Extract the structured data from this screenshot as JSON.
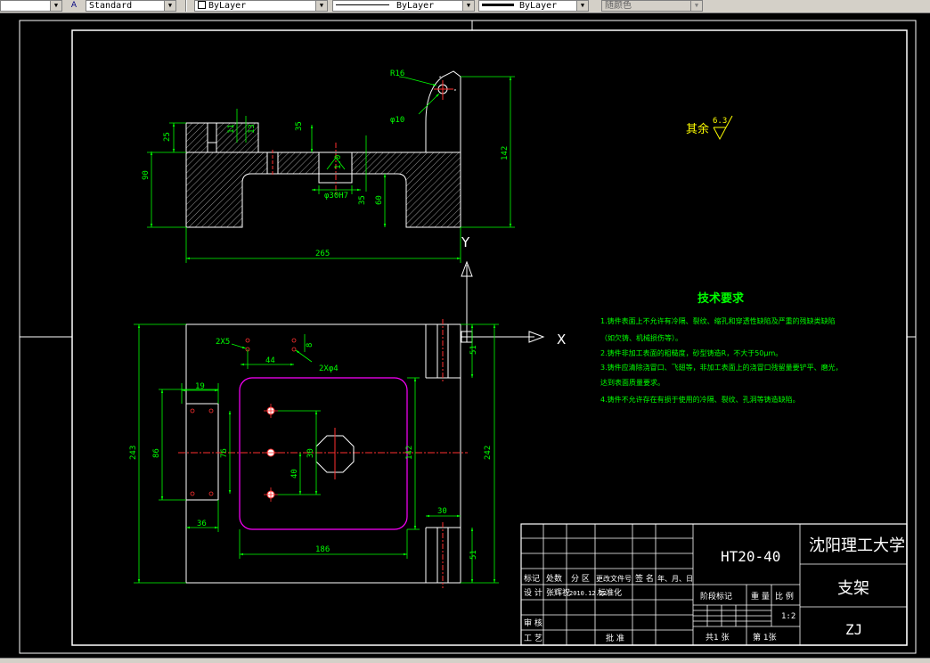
{
  "toolbar": {
    "text_style": "Standard",
    "layer": "ByLayer",
    "linetype": "ByLayer",
    "lineweight": "ByLayer",
    "plot_style": "随颜色"
  },
  "top_view": {
    "r16": "R16",
    "phi10": "φ10",
    "dim_11": "11",
    "dim_13": "13",
    "dim_35": "35",
    "dim_25": "25",
    "dim_90": "90",
    "dim_10": "1.0",
    "dim_phi30": "φ30H7",
    "dim_5": "35",
    "dim_60": "60",
    "dim_142": "142",
    "dim_265": "265"
  },
  "surface_note": {
    "label": "其余",
    "value": "6.3"
  },
  "tech_requirements": {
    "title": "技术要求",
    "lines": [
      "1.铸件表面上不允许有冷隔、裂纹、缩孔和穿透性缺陷及严重的残缺类缺陷",
      "（如欠铸、机械损伤等）。",
      "2.铸件非加工表面的粗糙度，砂型铸造R，不大于50μm。",
      "3.铸件应清除浇冒口、飞翅等，非加工表面上的浇冒口残留量要铲平、磨光，",
      "达到表面质量要求。",
      "4.铸件不允许存在有损于使用的冷隔、裂纹、孔洞等铸造缺陷。"
    ]
  },
  "front_view": {
    "dim_2x5": "2X5",
    "dim_44": "44",
    "dim_2xphi4": "2Xφ4",
    "dim_8": "8",
    "dim_19": "19",
    "dim_86": "86",
    "dim_76": "76",
    "dim_36": "36",
    "dim_40": "40",
    "dim_30v": "30",
    "dim_142b": "142",
    "dim_243": "243",
    "dim_242": "242",
    "dim_51a": "51",
    "dim_51b": "51",
    "dim_30h": "30",
    "dim_186": "186",
    "dim_36b": "36"
  },
  "axes": {
    "y_label": "Y",
    "x_label": "X"
  },
  "title_block": {
    "material": "HT20-40",
    "school": "沈阳理工大学",
    "part_name": "支架",
    "code": "ZJ",
    "row_headers": [
      "标记",
      "处数",
      "分 区",
      "更改文件号",
      "签 名",
      "年、月、日"
    ],
    "design_label": "设 计",
    "designer": "张辉祝",
    "date": "2010.12.22",
    "std_label": "标准化",
    "stage_label": "阶段标记",
    "weight_label": "重 量",
    "scale_label": "比 例",
    "scale": "1:2",
    "review_label": "审 核",
    "process_label": "工 艺",
    "approve_label": "批 准",
    "total_sheets": "共1  张",
    "sheet_no": "第  1张"
  }
}
